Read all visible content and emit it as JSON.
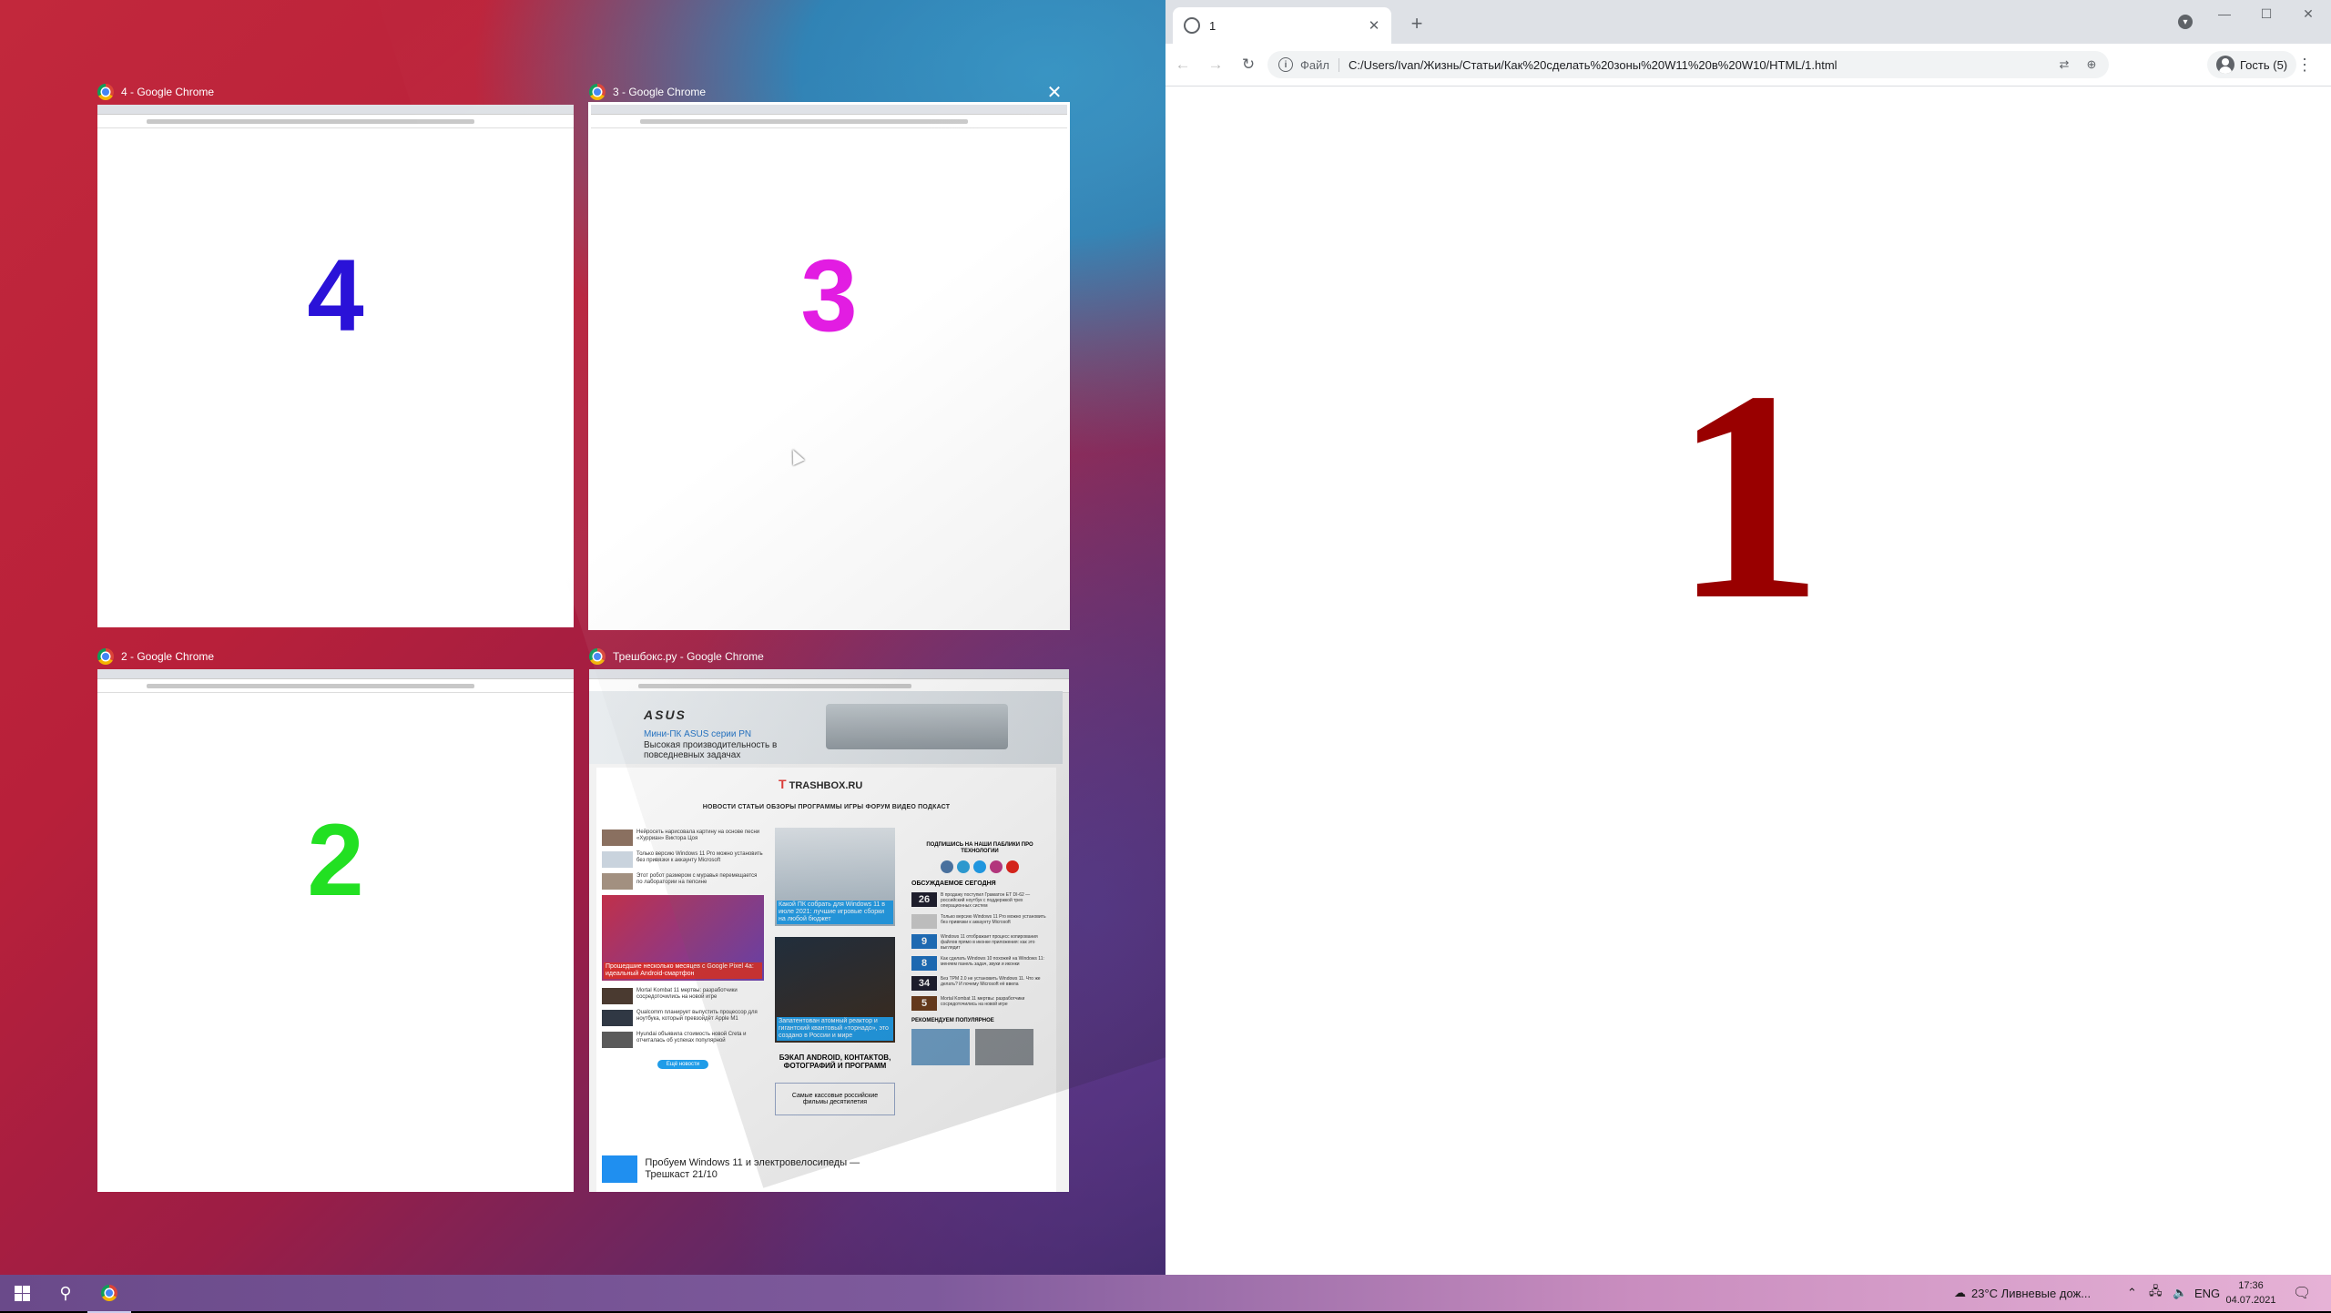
{
  "snap_assist": {
    "windows": [
      {
        "title": "4 - Google Chrome",
        "number": "4",
        "number_color": "#2a12d8"
      },
      {
        "title": "3 - Google Chrome",
        "number": "3",
        "number_color": "#e010e0"
      },
      {
        "title": "2 - Google Chrome",
        "number": "2",
        "number_color": "#22e022"
      },
      {
        "title": "Трешбокс.ру - Google Chrome"
      }
    ]
  },
  "trashbox": {
    "banner_brand": "ASUS",
    "banner_line1": "Мини-ПК ASUS серии PN",
    "banner_line2": "Высокая производительность в повседневных задачах",
    "logo": "TRASHBOX.RU",
    "nav": "НОВОСТИ  СТАТЬИ  ОБЗОРЫ  ПРОГРАММЫ  ИГРЫ  ФОРУМ  ВИДЕО  ПОДКАСТ",
    "news_left": [
      "Нейросеть нарисовала картину на основе песни «Хурриан» Виктора Цоя",
      "Только версию Windows 11 Pro можно установить без привязки к аккаунту Microsoft",
      "Этот робот размером с муравья перемещается по лаборатории на пепсине"
    ],
    "feature_left_caption": "Прошедшие несколько месяцев с Google Pixel 4a: идеальный Android-смартфон",
    "news_left2": [
      "Mortal Kombat 11 мертвы: разработчики сосредоточились на новой игре",
      "Qualcomm планирует выпустить процессор для ноутбука, который превзойдёт Apple M1",
      "Hyundai объявила стоимость новой Creta и отчиталась об успехах популярной"
    ],
    "more_button": "Ещё новости",
    "feature_mid_caption1": "Какой ПК собрать для Windows 11 в июле 2021: лучшие игровые сборки на любой бюджет",
    "feature_mid_caption2": "Запатентован атомный реактор и гигантский квантовый «торнадо», это создано в России и мире",
    "mid_heading": "БЭКАП ANDROID, КОНТАКТОВ, ФОТОГРАФИЙ И ПРОГРАММ",
    "mid_box": "Самые кассовые российские фильмы десятилетия",
    "bottom_article": "Пробуем Windows 11 и электровелосипеды — Трешкаст 21/10",
    "subscribe": "ПОДПИШИСЬ НА НАШИ ПАБЛИКИ ПРО ТЕХНОЛОГИИ",
    "discussed_heading": "ОБСУЖДАЕМОЕ СЕГОДНЯ",
    "discussed": [
      {
        "count": "26",
        "text": "В продажу поступил Граматон ЕТ DI-62 — российский ноутбук с поддержкой трех операционных систем"
      },
      {
        "count": "",
        "text": "Только версию Windows 11 Pro можно установить без привязки к аккаунту Microsoft"
      },
      {
        "count": "9",
        "text": "Windows 11 отображает процесс копирования файлов прямо в иконке приложения: как это выглядит"
      },
      {
        "count": "8",
        "text": "Как сделать Windows 10 похожей на Windows 11: меняем панель задач, звуки и иконки"
      },
      {
        "count": "34",
        "text": "Без TPM 2.0 не установить Windows 11. Что же делать? И почему Microsoft её ввела"
      },
      {
        "count": "5",
        "text": "Mortal Kombat 11 мертвы: разработчики сосредоточились на новой игре"
      }
    ],
    "popular_heading": "РЕКОМЕНДУЕМ ПОПУЛЯРНОЕ"
  },
  "chrome": {
    "tab_title": "1",
    "url_scheme": "Файл",
    "url": "C:/Users/Ivan/Жизнь/Статьи/Как%20сделать%20зоны%20W11%20в%20W10/HTML/1.html",
    "profile": "Гость (5)",
    "page_number": "1"
  },
  "taskbar": {
    "weather": "23°C  Ливневые дож...",
    "lang": "ENG",
    "time": "17:36",
    "date": "04.07.2021"
  }
}
